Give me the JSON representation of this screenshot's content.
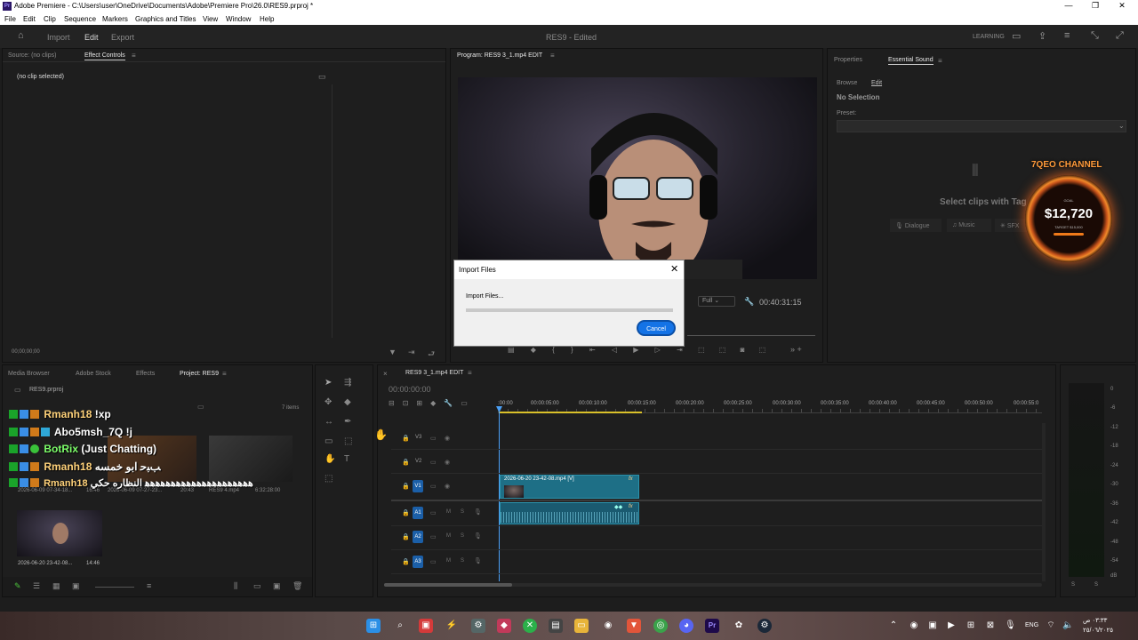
{
  "titlebar": {
    "text": "Adobe Premiere - C:\\Users\\user\\OneDrive\\Documents\\Adobe\\Premiere Pro\\26.0\\RES9.prproj *",
    "app_icon": "Pr",
    "minimize": "—",
    "maximize": "❐",
    "close": "✕"
  },
  "menu": [
    "File",
    "Edit",
    "Clip",
    "Sequence",
    "Markers",
    "Graphics and Titles",
    "View",
    "Window",
    "Help"
  ],
  "header": {
    "home_icon": "home-icon",
    "workspaces": [
      "Import",
      "Edit",
      "Export"
    ],
    "active_workspace": "Edit",
    "project_title": "RES9 - Edited",
    "learning": "LEARNING"
  },
  "source_panel": {
    "tabs": [
      "Source: (no clips)",
      "Effect Controls"
    ],
    "active_tab": "Effect Controls",
    "no_clip": "(no clip selected)",
    "timecode": "00;00;00;00"
  },
  "program_panel": {
    "title": "Program: RES9 3_1.mp4 EDIT",
    "zoom": "Full",
    "timecode": "00:40:31:15"
  },
  "import_dialog": {
    "title": "Import Files",
    "status": "Import Files...",
    "cancel": "Cancel",
    "close": "✕"
  },
  "essential_sound": {
    "tabs": [
      "Properties",
      "Essential Sound"
    ],
    "active_tab": "Essential Sound",
    "subtabs": [
      "Browse",
      "Edit"
    ],
    "no_selection": "No Selection",
    "preset_label": "Preset:",
    "hint": "Select clips with Tag",
    "types": [
      "Dialogue",
      "Music",
      "SFX"
    ]
  },
  "donation_overlay": {
    "channel": "7QEO CHANNEL",
    "amount": "$12,720",
    "small_top": "GOAL",
    "small_bottom": "TARGET $15,000"
  },
  "project_panel": {
    "tabs": [
      "Media Browser",
      "Adobe Stock",
      "Effects",
      "Project: RES9"
    ],
    "active_tab": "Project: RES9",
    "project_file": "RES9.prproj",
    "item_count": "7 items",
    "thumbs": [
      {
        "name": "2026-06-09 07-34-18...",
        "duration": "16:46"
      },
      {
        "name": "2026-06-09 07-27-23...",
        "duration": "20:43"
      },
      {
        "name": "RES9 4.mp4",
        "duration": "6:32:28:00"
      },
      {
        "name": "2026-06-20 23-42-08...",
        "duration": "14:46"
      }
    ]
  },
  "chat": [
    {
      "user": "Rmanh18",
      "msg": "!xp",
      "color": "#ffd27a"
    },
    {
      "user": "Abo5msh_7Q",
      "msg": "!j",
      "color": "#ffffff"
    },
    {
      "user": "BotRix",
      "msg": "(Just Chatting)",
      "color": "#7dff6a"
    },
    {
      "user": "Rmanh18",
      "msg": "ﺐﺒﺣ ﺍﺑﻮ ﺧﻤﺴﻪ",
      "color": "#ffd27a"
    },
    {
      "user": "Rmanh18",
      "msg": "ﻫﻫﻫﻫﻫﻫﻫﻫﻫﻫﻫﻫﻫﻫﻫﻫﻫﻫﻫﻫﻫ ﺍﻟﻨﻈﺎﺭﻩ ﺣﻜﻲ",
      "color": "#ffd27a"
    }
  ],
  "timeline": {
    "sequence": "RES9 3_1.mp4 EDIT",
    "timecode": "00:00:00:00",
    "ruler": [
      ":00:00",
      "00:00:05:00",
      "00:00:10:00",
      "00:00:15:00",
      "00:00:20:00",
      "00:00:25:00",
      "00:00:30:00",
      "00:00:35:00",
      "00:00:40:00",
      "00:00:45:00",
      "00:00:50:00",
      "00:00:55:0"
    ],
    "video_tracks": [
      "V3",
      "V2",
      "V1"
    ],
    "audio_tracks": [
      "A1",
      "A2",
      "A3"
    ],
    "clip_name": "2026-06-20 23-42-08.mp4 [V]",
    "fx": "fx",
    "track_m": "M",
    "track_s": "S"
  },
  "meter": {
    "labels": [
      "0",
      "-6",
      "-12",
      "-18",
      "-24",
      "-30",
      "-36",
      "-42",
      "-48",
      "-54",
      "dB"
    ],
    "bottom": [
      "S",
      "S"
    ]
  },
  "taskbar": {
    "lang": "ENG",
    "time": "٠٣:٣٣ ص",
    "date": "٢٥/٠٦/٢٠٢٥"
  }
}
